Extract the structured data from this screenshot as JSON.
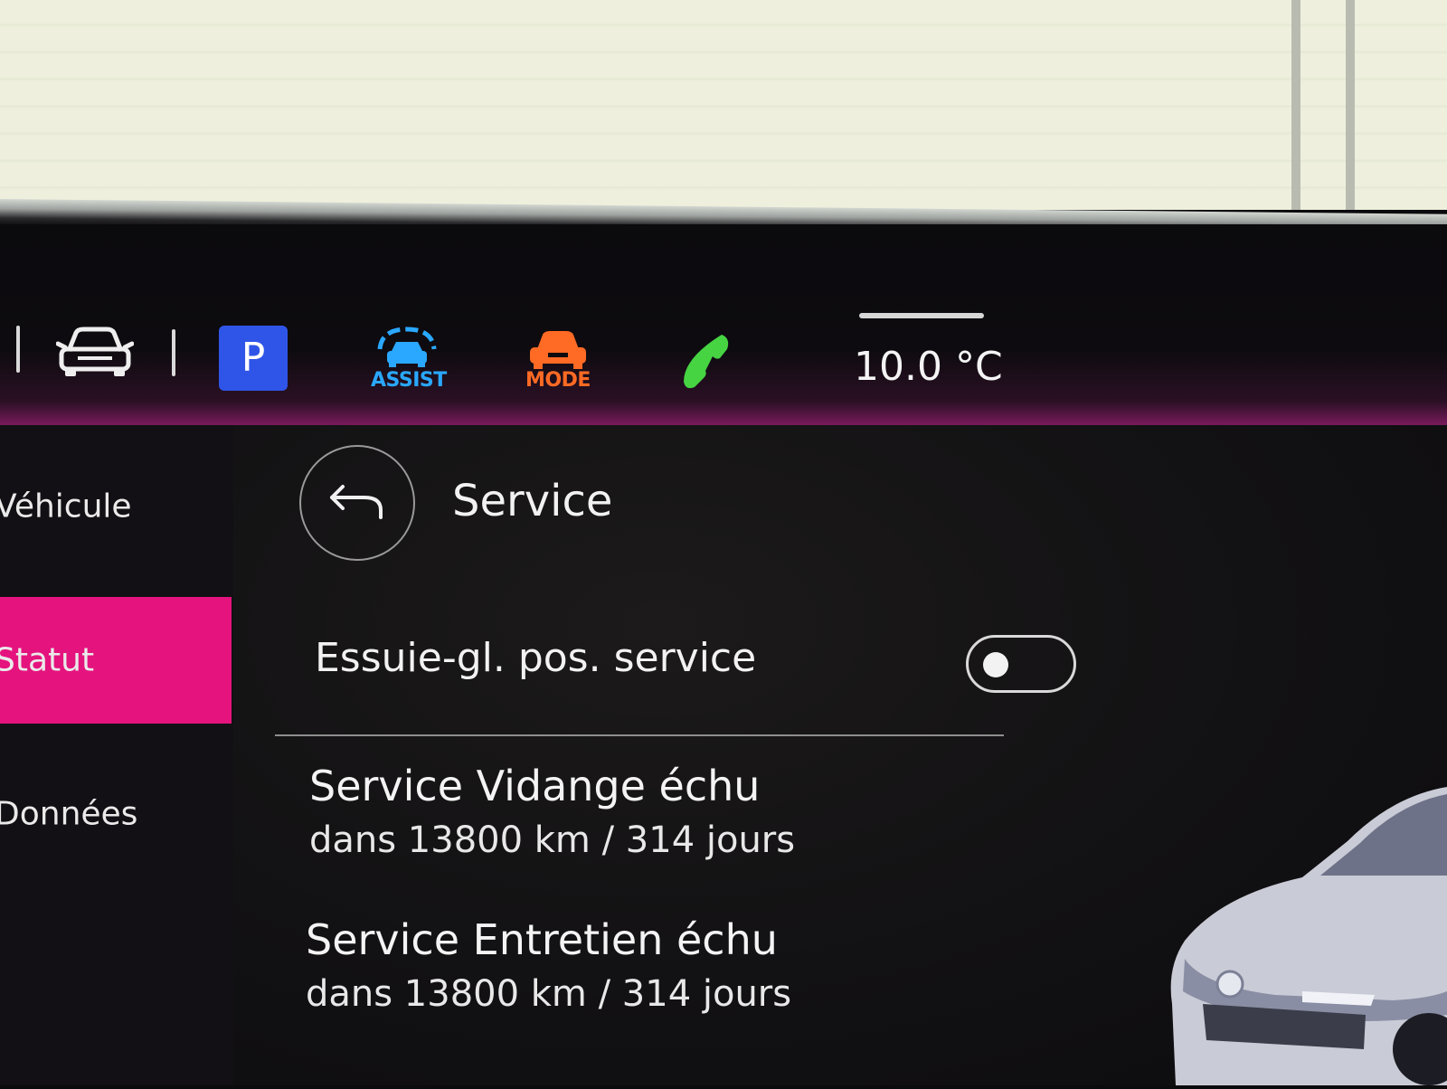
{
  "status_bar": {
    "park_label": "P",
    "assist_label": "ASSIST",
    "mode_label": "MODE",
    "temperature": "10.0 °C",
    "colors": {
      "park": "#2f55e8",
      "assist": "#2aa8ff",
      "mode": "#ff6a24",
      "phone": "#46d443"
    }
  },
  "sidebar": {
    "items": [
      {
        "label": "Véhicule",
        "active": false
      },
      {
        "label": "Statut",
        "active": true
      },
      {
        "label": "Données",
        "active": false
      }
    ],
    "accent": "#e5137e"
  },
  "page": {
    "title": "Service",
    "toggle_row": {
      "label": "Essuie-gl. pos. service",
      "on": false
    },
    "services": [
      {
        "title": "Service Vidange échu",
        "detail": "dans 13800 km / 314 jours"
      },
      {
        "title": "Service Entretien échu",
        "detail": "dans 13800 km / 314 jours"
      }
    ]
  }
}
